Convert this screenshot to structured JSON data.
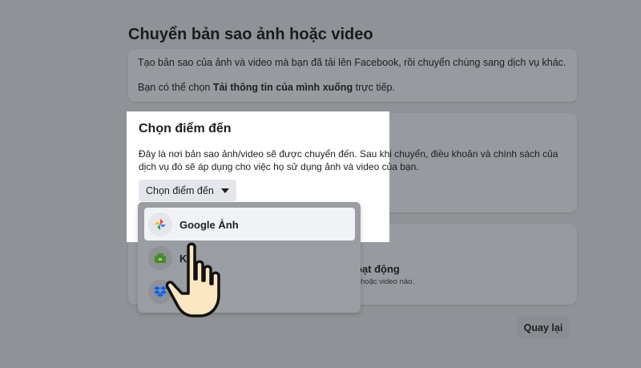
{
  "page": {
    "title": "Chuyển bản sao ảnh hoặc video"
  },
  "intro": {
    "line1": "Tạo bản sao của ảnh và video mà bạn đã tải lên Facebook, rồi chuyển chúng sang dịch vụ khác.",
    "line2_prefix": "Bạn có thể chọn ",
    "line2_link": "Tải thông tin của mình xuống",
    "line2_suffix": " trực tiếp."
  },
  "destination": {
    "heading": "Chọn điểm đến",
    "desc_line1": "Đây là nơi bản sao ảnh/video sẽ được chuyển đến. Sau khi chuyển, điều khoản và chính sách của",
    "desc_line2": "dịch vụ đó sẽ áp dụng cho việc họ sử dụng ảnh và video của bạn.",
    "select_label": "Chọn điểm đến",
    "options": [
      {
        "label": "Google Ảnh",
        "icon": "google-photos-icon"
      },
      {
        "label": "Ko",
        "icon": "koofr-icon"
      },
      {
        "label": "",
        "icon": "dropbox-icon"
      }
    ]
  },
  "activity": {
    "title": "oạt động",
    "subtitle": "hoặc video nào."
  },
  "footer": {
    "back_label": "Quay lại"
  },
  "colors": {
    "overlay": "#8f9296",
    "highlight": "#ffffff",
    "button_bg": "#e4e6eb"
  }
}
